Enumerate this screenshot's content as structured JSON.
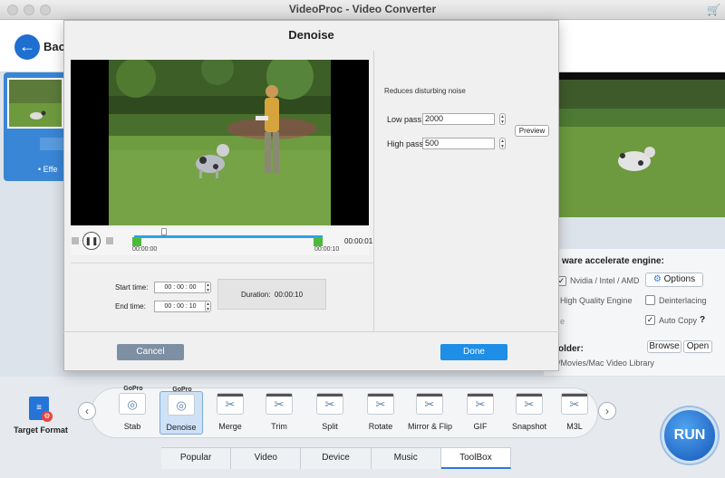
{
  "window": {
    "title": "VideoProc - Video Converter"
  },
  "header": {
    "back_label": "Back"
  },
  "left_panel": {
    "effect_text": "Effe"
  },
  "dialog": {
    "title": "Denoise",
    "hint": "Reduces disturbing noise",
    "low_pass_label": "Low pass:",
    "low_pass_value": "2000",
    "high_pass_label": "High pass:",
    "high_pass_value": "500",
    "preview_label": "Preview",
    "timeline_start": "00:00:00",
    "timeline_end": "00:00:10",
    "timeline_total": "00:00:01",
    "start_time_label": "Start time:",
    "start_time": {
      "h": "00",
      "m": "00",
      "s": "00"
    },
    "end_time_label": "End time:",
    "end_time": {
      "h": "00",
      "m": "00",
      "s": "10"
    },
    "duration_label": "Duration:",
    "duration_value": "00:00:10",
    "cancel_label": "Cancel",
    "done_label": "Done"
  },
  "settings": {
    "engine_label": "ware accelerate engine:",
    "nvidia_label": "Nvidia / Intel / AMD",
    "nvidia_checked": true,
    "options_label": "Options",
    "hq_label": "High Quality Engine",
    "deinterlacing_label": "Deinterlacing",
    "deinterlacing_checked": false,
    "autocopy_label": "Auto Copy",
    "autocopy_checked": true,
    "help_label": "?",
    "folder_label": "older:",
    "browse_label": "Browse",
    "open_label": "Open",
    "folder_path": "/Movies/Mac Video Library",
    "e_text": "e"
  },
  "toolbar": {
    "target_format_label": "Target Format",
    "run_label": "RUN",
    "tools": [
      {
        "label": "Stab",
        "gopro": "GoPro"
      },
      {
        "label": "Denoise",
        "gopro": "GoPro",
        "selected": true
      },
      {
        "label": "Merge"
      },
      {
        "label": "Trim"
      },
      {
        "label": "Split"
      },
      {
        "label": "Rotate"
      },
      {
        "label": "Mirror & Flip"
      },
      {
        "label": "GIF"
      },
      {
        "label": "Snapshot"
      },
      {
        "label": "M3L"
      }
    ],
    "tools_text": {
      "t0": "Stab",
      "t1": "Denoise",
      "t2": "Merge",
      "t3": "Trim",
      "t4": "Split",
      "t5": "Rotate",
      "t6": "Mirror & Flip",
      "t7": "GIF",
      "t8": "Snapshot",
      "t9": "M3L",
      "gopro": "GoPro"
    }
  },
  "tabs": [
    "Popular",
    "Video",
    "Device",
    "Music",
    "ToolBox"
  ],
  "tabs_text": {
    "t0": "Popular",
    "t1": "Video",
    "t2": "Device",
    "t3": "Music",
    "t4": "ToolBox"
  },
  "active_tab": "ToolBox",
  "colors": {
    "accent": "#1e8ee6",
    "run": "#1456b8",
    "handle": "#4cbb3b"
  }
}
